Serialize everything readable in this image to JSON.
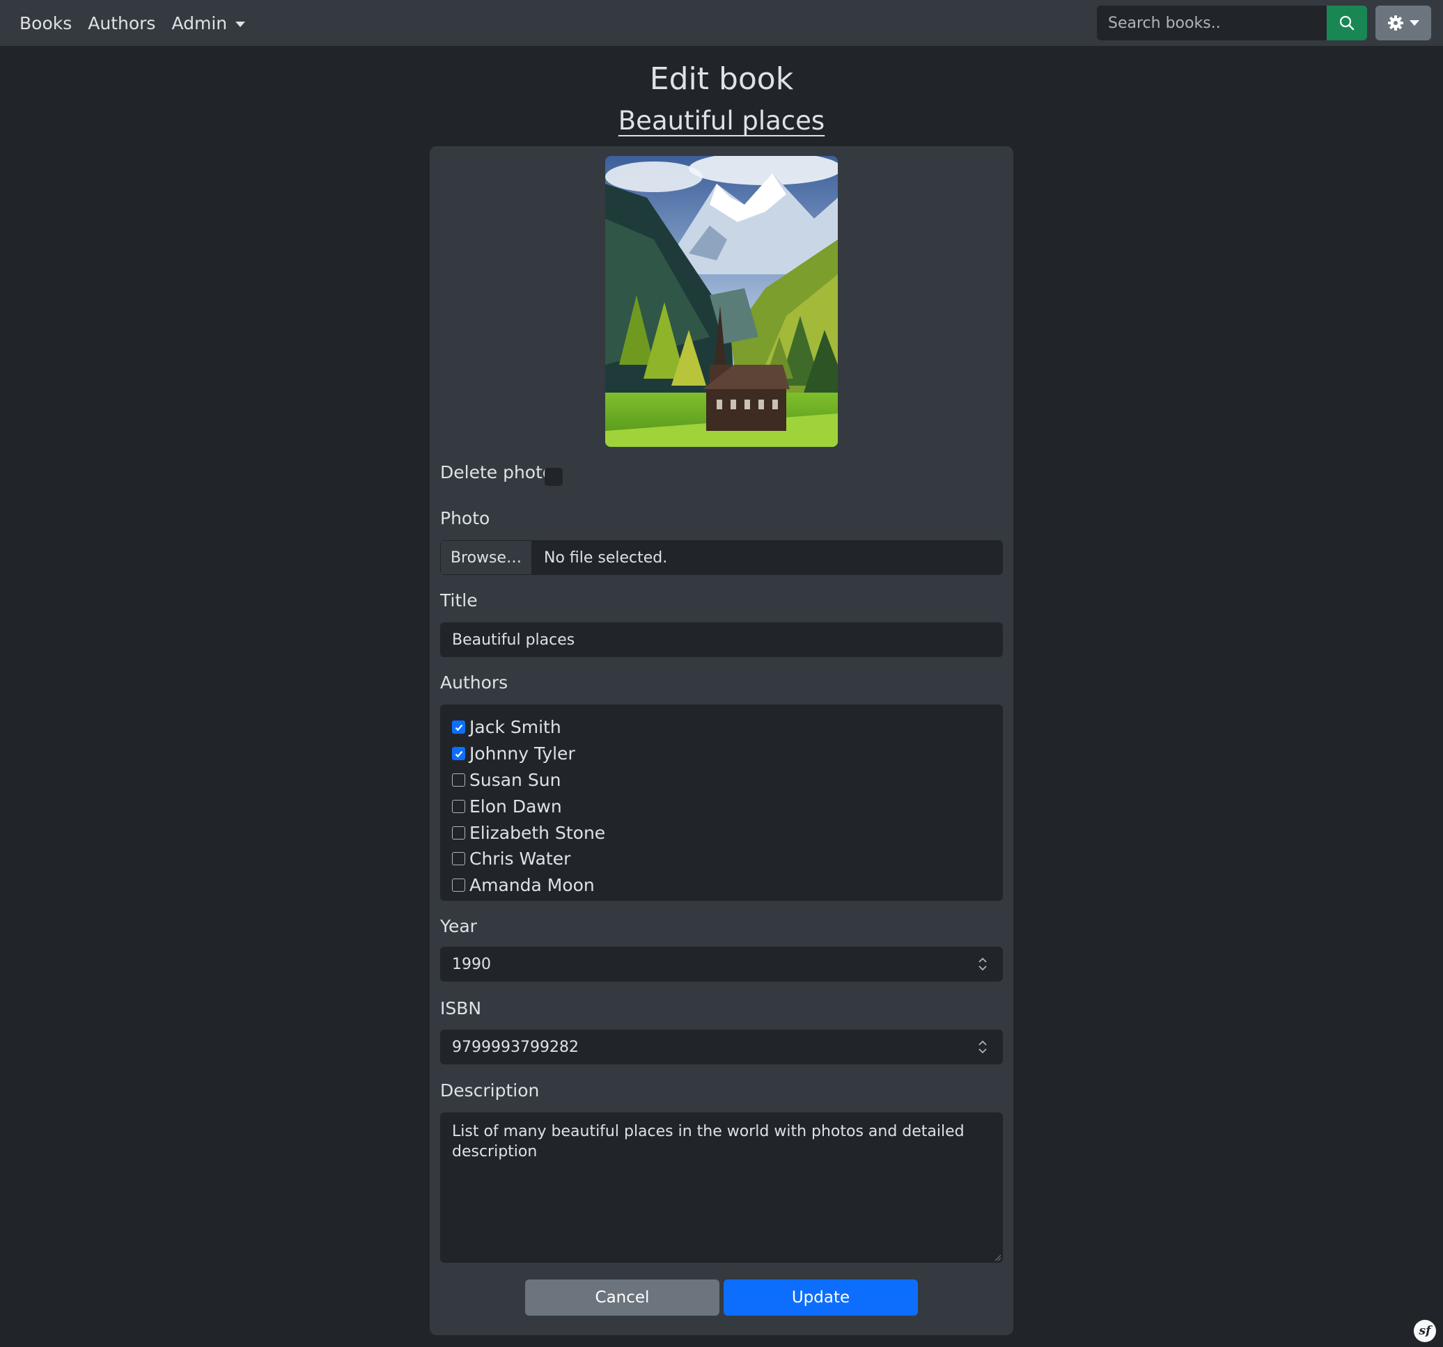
{
  "nav": {
    "links": [
      "Books",
      "Authors"
    ],
    "admin_label": "Admin",
    "search_placeholder": "Search books.."
  },
  "page": {
    "heading": "Edit book",
    "book_title_link": "Beautiful places"
  },
  "form": {
    "delete_photo_label": "Delete photo",
    "photo_label": "Photo",
    "browse_label": "Browse…",
    "file_status": "No file selected.",
    "title_label": "Title",
    "title_value": "Beautiful places",
    "authors_label": "Authors",
    "authors": [
      {
        "name": "Jack Smith",
        "checked": true
      },
      {
        "name": "Johnny Tyler",
        "checked": true
      },
      {
        "name": "Susan Sun",
        "checked": false
      },
      {
        "name": "Elon Dawn",
        "checked": false
      },
      {
        "name": "Elizabeth Stone",
        "checked": false
      },
      {
        "name": "Chris Water",
        "checked": false
      },
      {
        "name": "Amanda Moon",
        "checked": false
      }
    ],
    "year_label": "Year",
    "year_value": "1990",
    "isbn_label": "ISBN",
    "isbn_value": "9799993799282",
    "description_label": "Description",
    "description_value": "List of many beautiful places in the world with photos and detailed description",
    "cancel_label": "Cancel",
    "update_label": "Update"
  },
  "colors": {
    "page_bg": "#212529",
    "navbar_bg": "#343a40",
    "search_button": "#198754",
    "primary": "#0d6efd",
    "secondary": "#6c757d"
  },
  "icons": [
    "search-icon",
    "gear-icon",
    "chevron-down-icon",
    "symfony-logo-icon"
  ]
}
